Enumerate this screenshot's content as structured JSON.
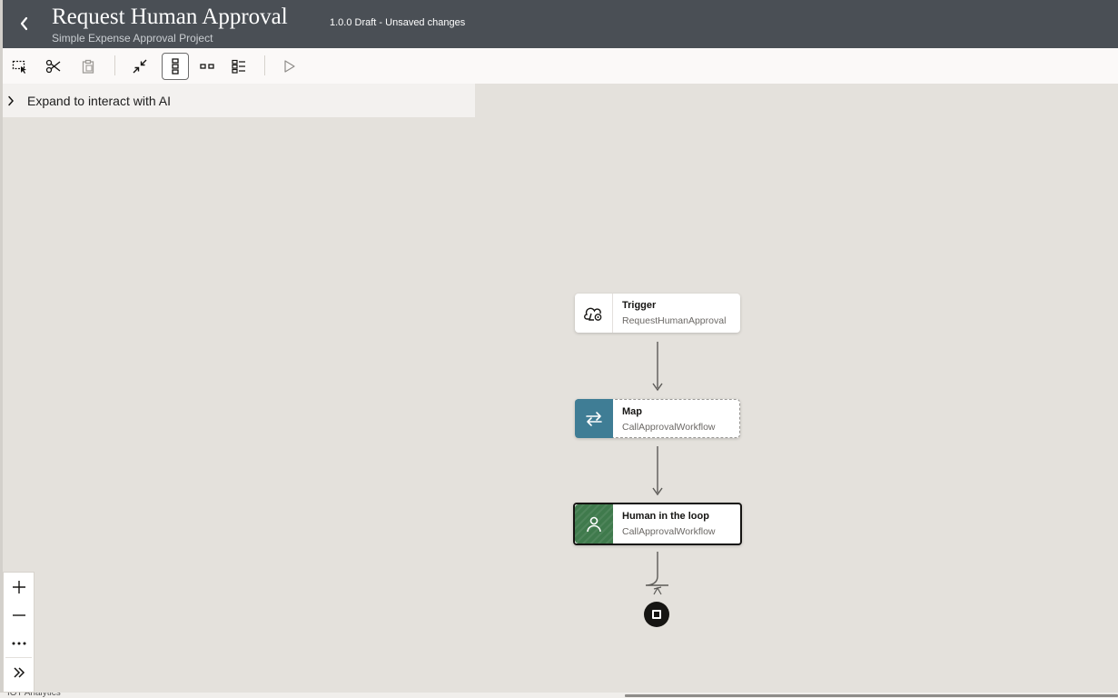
{
  "header": {
    "back_icon": "chevron-left-icon",
    "title": "Request Human Approval",
    "subtitle": "Simple Expense Approval Project",
    "version_status": "1.0.0 Draft - Unsaved changes",
    "background_color": "#4a4f55"
  },
  "toolbar": {
    "buttons": [
      {
        "icon": "select-region-icon",
        "active": false
      },
      {
        "icon": "cut-icon",
        "active": false
      },
      {
        "icon": "paste-icon",
        "active": false
      },
      {
        "icon": "collapse-icon",
        "active": false
      },
      {
        "icon": "vertical-layout-icon",
        "active": true
      },
      {
        "icon": "horizontal-layout-icon",
        "active": false
      },
      {
        "icon": "pseudo-view-icon",
        "active": false
      },
      {
        "icon": "run-icon",
        "active": false
      }
    ]
  },
  "ai_panel": {
    "label": "Expand to interact with AI",
    "icon": "chevron-right-icon"
  },
  "flow": {
    "nodes": [
      {
        "type": "Trigger",
        "name": "RequestHumanApproval",
        "icon": "trigger-cloud-icon"
      },
      {
        "type": "Map",
        "name": "CallApprovalWorkflow",
        "icon": "swap-arrows-icon",
        "color": "#3f7d95"
      },
      {
        "type": "Human in the loop",
        "name": "CallApprovalWorkflow",
        "icon": "person-icon",
        "color": "#3f7a4c"
      }
    ],
    "end_icon": "stop-square-icon"
  },
  "zoom_controls": {
    "items": [
      "zoom-in-icon",
      "zoom-out-icon",
      "more-options-icon",
      "expand-panel-icon"
    ]
  },
  "footer": {
    "text": "IOT Analytics"
  }
}
